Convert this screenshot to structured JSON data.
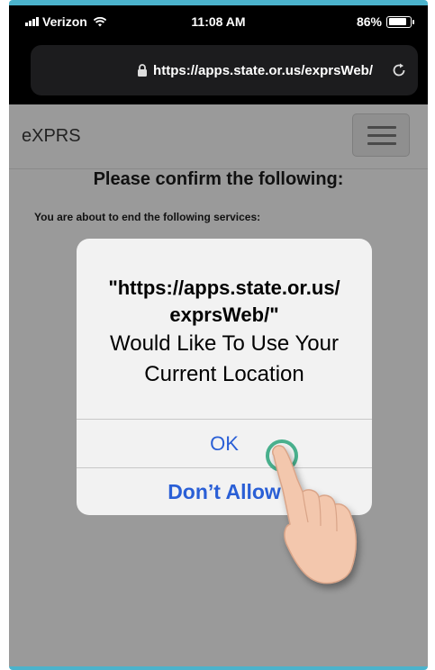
{
  "status_bar": {
    "carrier": "Verizon",
    "time": "11:08 AM",
    "battery_percent": "86%",
    "battery_level": 0.86
  },
  "browser": {
    "url": "https://apps.state.or.us/exprsWeb/"
  },
  "page": {
    "brand": "eXPRS",
    "title": "Please confirm the following:",
    "subtitle": "You are about to end the following services:"
  },
  "alert": {
    "origin": "\"https://apps.state.or.us/ exprsWeb/\"",
    "message": "Would Like To Use Your Current Location",
    "ok_label": "OK",
    "deny_label": "Don’t Allow"
  },
  "colors": {
    "frame": "#4bb3cc",
    "alert_button": "#2a5fd6",
    "tap_ring": "#49b08d"
  },
  "icons": [
    "signal-icon",
    "wifi-icon",
    "battery-icon",
    "lock-icon",
    "reload-icon",
    "menu-icon",
    "hand-pointer-icon"
  ]
}
